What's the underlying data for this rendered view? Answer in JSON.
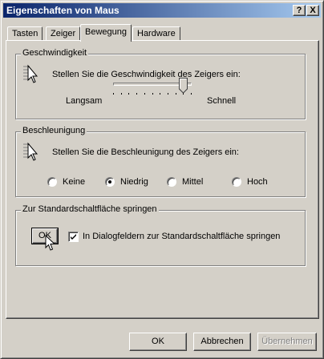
{
  "window": {
    "title": "Eigenschaften von Maus",
    "help_button": "?",
    "close_button": "X"
  },
  "tabs": [
    {
      "label": "Tasten",
      "active": false
    },
    {
      "label": "Zeiger",
      "active": false
    },
    {
      "label": "Bewegung",
      "active": true
    },
    {
      "label": "Hardware",
      "active": false
    }
  ],
  "speed": {
    "legend": "Geschwindigkeit",
    "description": "Stellen Sie die Geschwindigkeit des Zeigers ein:",
    "label_slow": "Langsam",
    "label_fast": "Schnell",
    "slider_position": 0.9,
    "slider_ticks": 11
  },
  "acceleration": {
    "legend": "Beschleunigung",
    "description": "Stellen Sie die Beschleunigung des Zeigers ein:",
    "options": [
      {
        "label": "Keine",
        "selected": false
      },
      {
        "label": "Niedrig",
        "selected": true
      },
      {
        "label": "Mittel",
        "selected": false
      },
      {
        "label": "Hoch",
        "selected": false
      }
    ]
  },
  "snap": {
    "legend": "Zur Standardschaltfläche springen",
    "sample_button": "OK",
    "checkbox_label": "In Dialogfeldern zur Standardschaltfläche springen",
    "checked": true
  },
  "footer": {
    "ok": "OK",
    "cancel": "Abbrechen",
    "apply": "Übernehmen",
    "apply_enabled": false
  },
  "colors": {
    "face": "#d4d0c8",
    "title_start": "#0a246a",
    "title_end": "#a6caf0"
  }
}
